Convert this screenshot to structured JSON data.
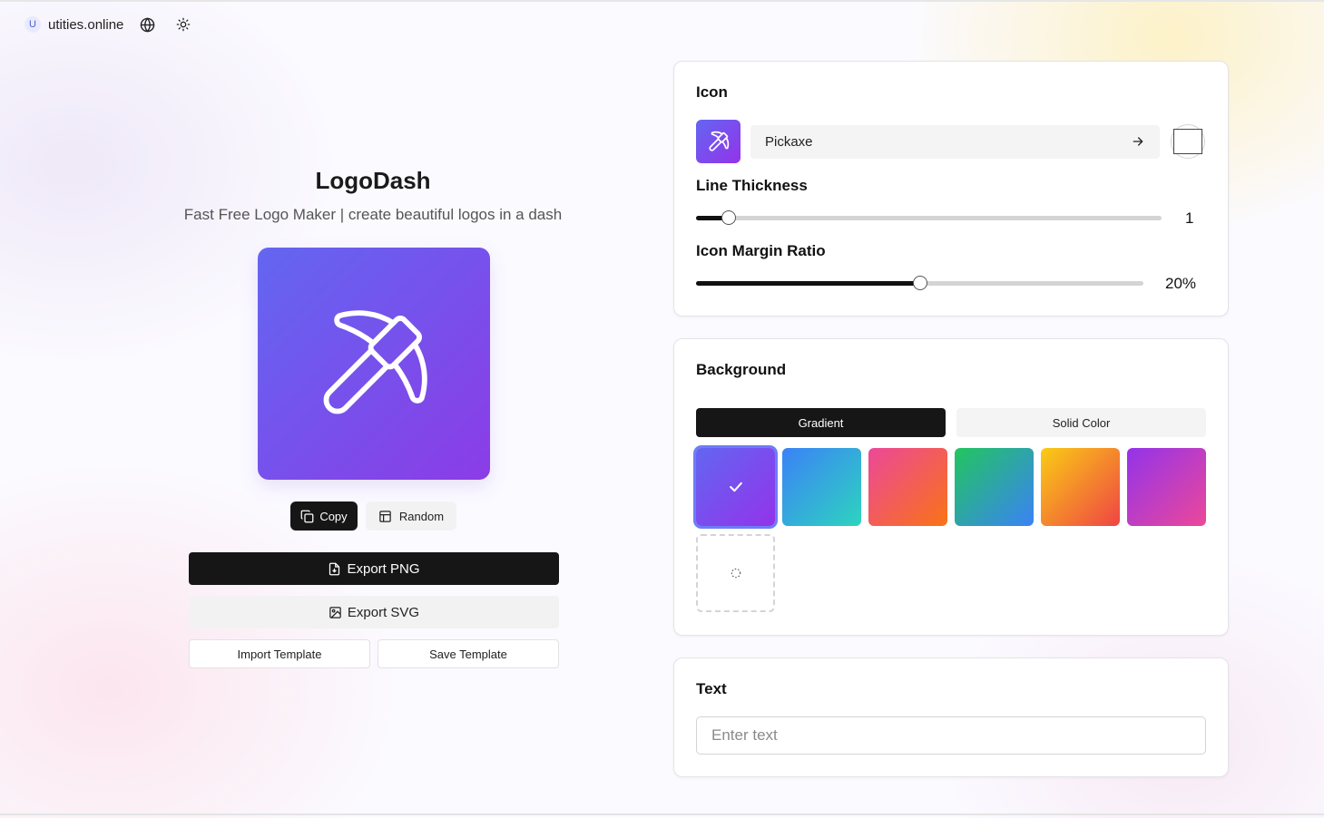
{
  "header": {
    "badge": "U",
    "site_name": "utities.online",
    "icons": [
      "globe-icon",
      "sun-icon"
    ]
  },
  "hero": {
    "title": "LogoDash",
    "subtitle": "Fast Free Logo Maker | create beautiful logos in a dash"
  },
  "preview": {
    "icon": "pickaxe-icon",
    "gradient": [
      "#6366f1",
      "#8b3ce6"
    ]
  },
  "actions": {
    "copy_label": "Copy",
    "random_label": "Random",
    "export_png_label": "Export PNG",
    "export_svg_label": "Export SVG",
    "import_template_label": "Import Template",
    "save_template_label": "Save Template"
  },
  "icon_panel": {
    "title": "Icon",
    "selected_icon": "Pickaxe",
    "icon_color": "#ffffff",
    "line_thickness": {
      "label": "Line Thickness",
      "value": "1",
      "level": 0.07
    },
    "margin_ratio": {
      "label": "Icon Margin Ratio",
      "value": "20%",
      "level": 0.5
    }
  },
  "background_panel": {
    "title": "Background",
    "tabs": [
      {
        "label": "Gradient",
        "active": true
      },
      {
        "label": "Solid Color",
        "active": false
      }
    ],
    "gradients": [
      {
        "from": "#6366f1",
        "to": "#9333ea",
        "selected": true
      },
      {
        "from": "#3b82f6",
        "to": "#2dd4bf",
        "selected": false
      },
      {
        "from": "#ec4899",
        "to": "#f97316",
        "selected": false
      },
      {
        "from": "#22c55e",
        "to": "#3b82f6",
        "selected": false
      },
      {
        "from": "#facc15",
        "to": "#ef4444",
        "selected": false
      },
      {
        "from": "#9333ea",
        "to": "#ec4899",
        "selected": false
      }
    ]
  },
  "text_panel": {
    "title": "Text",
    "placeholder": "Enter text",
    "value": ""
  }
}
